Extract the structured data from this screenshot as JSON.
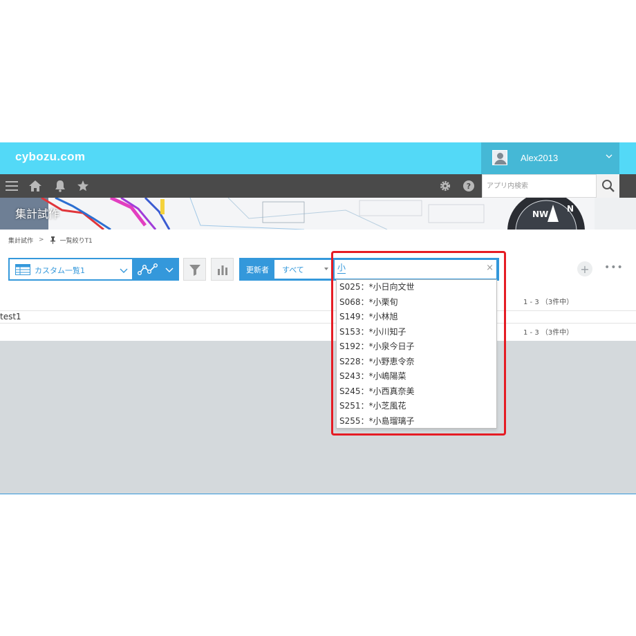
{
  "brand": {
    "logo": "cybozu.com"
  },
  "user": {
    "name": "Alex2013"
  },
  "toolbar": {
    "search_placeholder": "アプリ内検索"
  },
  "app": {
    "title": "集計試作"
  },
  "breadcrumb": {
    "app": "集計試作",
    "separator": ">",
    "view": "一覧絞りT1"
  },
  "view_selector": {
    "label": "カスタム一覧1"
  },
  "filter_bar": {
    "updater_label": "更新者",
    "updater_value": "すべて",
    "user_input": "小",
    "clear": "×"
  },
  "actions": {
    "add": "+",
    "more": "•••"
  },
  "list": {
    "count_top": "1 - 3 （3件中）",
    "count_bottom": "1 - 3 （3件中）",
    "record": "test1"
  },
  "suggestions": [
    "S025：*小日向文世",
    "S068：*小栗旬",
    "S149：*小林旭",
    "S153：*小川知子",
    "S192：*小泉今日子",
    "S228：*小野恵令奈",
    "S243：*小嶋陽菜",
    "S245：*小西真奈美",
    "S251：*小芝風花",
    "S255：*小島瑠璃子"
  ],
  "colors": {
    "brand": "#53d9f7",
    "toolbar": "#4a4a4a",
    "accent": "#3498db",
    "highlight": "#e51c24"
  }
}
